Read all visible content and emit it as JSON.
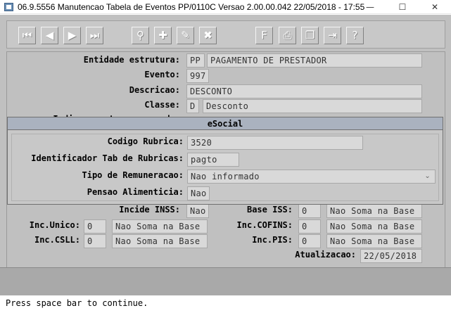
{
  "window": {
    "title": "06.9.5556 Manutencao  Tabela de Eventos PP/0110C Versao 2.00.00.042 22/05/2018 - 17:55",
    "minimize_glyph": "—",
    "maximize_glyph": "☐",
    "close_glyph": "✕"
  },
  "toolbar": {
    "icons": [
      "first-record-icon",
      "previous-record-icon",
      "next-record-icon",
      "last-record-icon",
      "search-icon",
      "add-icon",
      "edit-icon",
      "delete-icon",
      "filter-icon",
      "print-icon",
      "copy-icon",
      "exit-icon",
      "help-icon"
    ],
    "glyphs": {
      "first": "⏮",
      "previous": "◀",
      "next": "▶",
      "last": "⏭",
      "search": "⚲",
      "add": "✚",
      "edit": "✎",
      "delete": "✖",
      "filter": "F",
      "print": "⎙",
      "copy": "❐",
      "exit": "⇥",
      "help": "?"
    }
  },
  "form": {
    "entidade": {
      "label": "Entidade estrutura:",
      "code": "PP",
      "value": "PAGAMENTO DE PRESTADOR"
    },
    "evento": {
      "label": "Evento:",
      "value": "997"
    },
    "descricao": {
      "label": "Descricao:",
      "value": "DESCONTO"
    },
    "classe": {
      "label": "Classe:",
      "code": "D",
      "value": "Desconto"
    },
    "indice": {
      "label": "Indice evento processado:"
    },
    "incide_inss": {
      "label": "Incide INSS:",
      "value": "Nao"
    },
    "base_iss": {
      "label": "Base ISS:",
      "code": "0",
      "value": "Nao Soma na Base"
    },
    "inc_unico": {
      "label": "Inc.Unico:",
      "code": "0",
      "value": "Nao Soma na Base"
    },
    "inc_cofins": {
      "label": "Inc.COFINS:",
      "code": "0",
      "value": "Nao Soma na Base"
    },
    "inc_csll": {
      "label": "Inc.CSLL:",
      "code": "0",
      "value": "Nao Soma na Base"
    },
    "inc_pis": {
      "label": "Inc.PIS:",
      "code": "0",
      "value": "Nao Soma na Base"
    },
    "atualizacao": {
      "label": "Atualizacao:",
      "value": "22/05/2018"
    }
  },
  "esocial": {
    "title": "eSocial",
    "codigo_rubrica": {
      "label": "Codigo Rubrica:",
      "value": "3520"
    },
    "identificador": {
      "label": "Identificador Tab de Rubricas:",
      "value": "pagto"
    },
    "tipo_remuneracao": {
      "label": "Tipo de Remuneracao:",
      "value": "Nao informado",
      "caret": "⌄"
    },
    "pensao": {
      "label": "Pensao Alimenticia:",
      "value": "Nao"
    }
  },
  "console": {
    "message": "Press space bar to continue."
  }
}
